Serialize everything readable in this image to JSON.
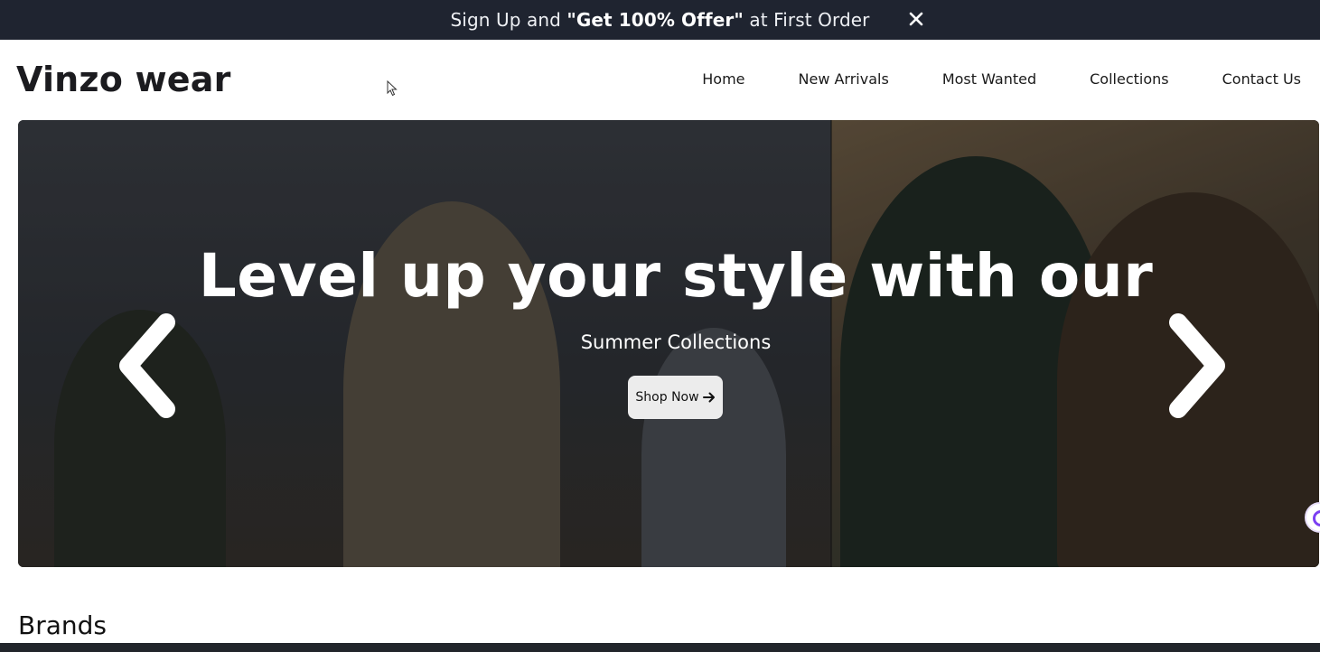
{
  "promo": {
    "text_prefix": "Sign Up and ",
    "text_bold": "\"Get 100% Offer\"",
    "text_suffix": " at First Order",
    "close_icon": "close-icon"
  },
  "header": {
    "logo": "Vinzo wear",
    "nav": [
      "Home",
      "New Arrivals",
      "Most Wanted",
      "Collections",
      "Contact Us"
    ]
  },
  "hero": {
    "title": "Level up your style with our",
    "subtitle": "Summer Collections",
    "cta_label": "Shop Now",
    "cta_icon": "arrow-right-icon",
    "prev_icon": "chevron-left-icon",
    "next_icon": "chevron-right-icon"
  },
  "sections": {
    "brands_title": "Brands"
  },
  "colors": {
    "promo_bg": "#1f2430",
    "cta_bg": "#ececec",
    "widget_accent": "#7b3ff2"
  }
}
